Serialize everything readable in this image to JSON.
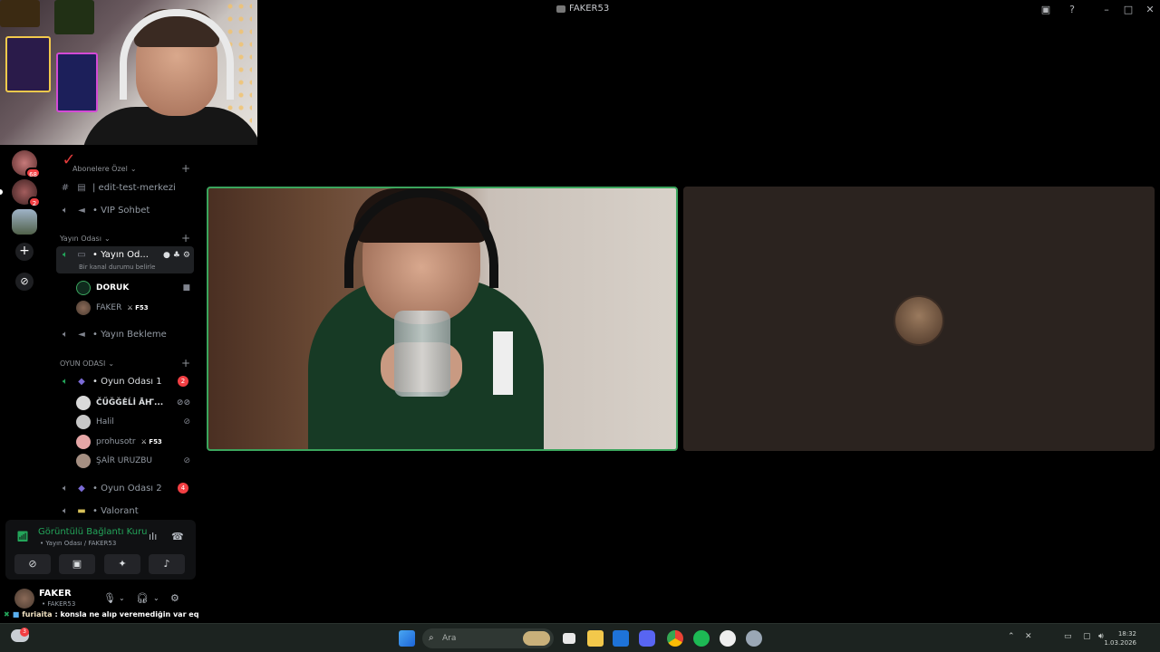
{
  "window": {
    "title": "FAKER53"
  },
  "servers": [
    {
      "badge": "68"
    },
    {
      "badge": "2"
    }
  ],
  "sidebar": {
    "top_category": "Abonelere Özel",
    "channels_top": [
      {
        "name": "| edit-test-merkezi"
      },
      {
        "name": "• VIP Sohbet"
      }
    ],
    "cat_yayin": "Yayın Odası",
    "yayin_channel": {
      "name": "• Yayın Od...",
      "sub": "Bir kanal durumu belirle"
    },
    "yayin_users": [
      {
        "name": "DORUK"
      },
      {
        "name": "FAKER",
        "tag": "F53"
      }
    ],
    "yayin_bekleme": "• Yayın Bekleme",
    "cat_oyun": "OYUN ODASI",
    "oyun1": {
      "name": "• Oyun Odası 1",
      "badge": "2"
    },
    "oyun1_users": [
      {
        "name": "ČŰĞĞĖĹİ ĀҤ..."
      },
      {
        "name": "Halil"
      },
      {
        "name": "prohusotr",
        "tag": "F53"
      },
      {
        "name": "ŞAİR URUZBU"
      }
    ],
    "oyun2": {
      "name": "• Oyun Odası 2",
      "badge": "4"
    },
    "valorant": "• Valorant"
  },
  "voice_panel": {
    "status": "Görüntülü Bağlantı Kuru",
    "location": "• Yayın Odası / FAKER53"
  },
  "user_panel": {
    "name": "FAKER",
    "handle": "• FAKER53"
  },
  "chat_overlay": {
    "user": "furiaita",
    "message": ": konsla ne alıp veremediğin var eq akjfbksaf"
  },
  "taskbar": {
    "search_placeholder": "Ara",
    "clock_time": "18:32",
    "clock_date": "1.03.2026",
    "notif_badge": "3"
  },
  "colors": {
    "accent_green": "#23a55a",
    "badge_red": "#f23f43",
    "tile_border": "#3ba55d"
  }
}
